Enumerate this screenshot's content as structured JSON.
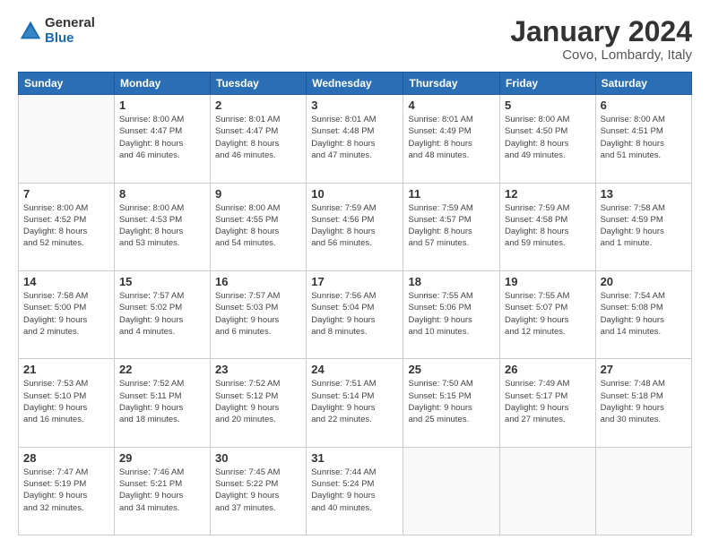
{
  "logo": {
    "general": "General",
    "blue": "Blue"
  },
  "header": {
    "title": "January 2024",
    "subtitle": "Covo, Lombardy, Italy"
  },
  "weekdays": [
    "Sunday",
    "Monday",
    "Tuesday",
    "Wednesday",
    "Thursday",
    "Friday",
    "Saturday"
  ],
  "weeks": [
    [
      {
        "day": "",
        "info": ""
      },
      {
        "day": "1",
        "info": "Sunrise: 8:00 AM\nSunset: 4:47 PM\nDaylight: 8 hours\nand 46 minutes."
      },
      {
        "day": "2",
        "info": "Sunrise: 8:01 AM\nSunset: 4:47 PM\nDaylight: 8 hours\nand 46 minutes."
      },
      {
        "day": "3",
        "info": "Sunrise: 8:01 AM\nSunset: 4:48 PM\nDaylight: 8 hours\nand 47 minutes."
      },
      {
        "day": "4",
        "info": "Sunrise: 8:01 AM\nSunset: 4:49 PM\nDaylight: 8 hours\nand 48 minutes."
      },
      {
        "day": "5",
        "info": "Sunrise: 8:00 AM\nSunset: 4:50 PM\nDaylight: 8 hours\nand 49 minutes."
      },
      {
        "day": "6",
        "info": "Sunrise: 8:00 AM\nSunset: 4:51 PM\nDaylight: 8 hours\nand 51 minutes."
      }
    ],
    [
      {
        "day": "7",
        "info": "Sunrise: 8:00 AM\nSunset: 4:52 PM\nDaylight: 8 hours\nand 52 minutes."
      },
      {
        "day": "8",
        "info": "Sunrise: 8:00 AM\nSunset: 4:53 PM\nDaylight: 8 hours\nand 53 minutes."
      },
      {
        "day": "9",
        "info": "Sunrise: 8:00 AM\nSunset: 4:55 PM\nDaylight: 8 hours\nand 54 minutes."
      },
      {
        "day": "10",
        "info": "Sunrise: 7:59 AM\nSunset: 4:56 PM\nDaylight: 8 hours\nand 56 minutes."
      },
      {
        "day": "11",
        "info": "Sunrise: 7:59 AM\nSunset: 4:57 PM\nDaylight: 8 hours\nand 57 minutes."
      },
      {
        "day": "12",
        "info": "Sunrise: 7:59 AM\nSunset: 4:58 PM\nDaylight: 8 hours\nand 59 minutes."
      },
      {
        "day": "13",
        "info": "Sunrise: 7:58 AM\nSunset: 4:59 PM\nDaylight: 9 hours\nand 1 minute."
      }
    ],
    [
      {
        "day": "14",
        "info": "Sunrise: 7:58 AM\nSunset: 5:00 PM\nDaylight: 9 hours\nand 2 minutes."
      },
      {
        "day": "15",
        "info": "Sunrise: 7:57 AM\nSunset: 5:02 PM\nDaylight: 9 hours\nand 4 minutes."
      },
      {
        "day": "16",
        "info": "Sunrise: 7:57 AM\nSunset: 5:03 PM\nDaylight: 9 hours\nand 6 minutes."
      },
      {
        "day": "17",
        "info": "Sunrise: 7:56 AM\nSunset: 5:04 PM\nDaylight: 9 hours\nand 8 minutes."
      },
      {
        "day": "18",
        "info": "Sunrise: 7:55 AM\nSunset: 5:06 PM\nDaylight: 9 hours\nand 10 minutes."
      },
      {
        "day": "19",
        "info": "Sunrise: 7:55 AM\nSunset: 5:07 PM\nDaylight: 9 hours\nand 12 minutes."
      },
      {
        "day": "20",
        "info": "Sunrise: 7:54 AM\nSunset: 5:08 PM\nDaylight: 9 hours\nand 14 minutes."
      }
    ],
    [
      {
        "day": "21",
        "info": "Sunrise: 7:53 AM\nSunset: 5:10 PM\nDaylight: 9 hours\nand 16 minutes."
      },
      {
        "day": "22",
        "info": "Sunrise: 7:52 AM\nSunset: 5:11 PM\nDaylight: 9 hours\nand 18 minutes."
      },
      {
        "day": "23",
        "info": "Sunrise: 7:52 AM\nSunset: 5:12 PM\nDaylight: 9 hours\nand 20 minutes."
      },
      {
        "day": "24",
        "info": "Sunrise: 7:51 AM\nSunset: 5:14 PM\nDaylight: 9 hours\nand 22 minutes."
      },
      {
        "day": "25",
        "info": "Sunrise: 7:50 AM\nSunset: 5:15 PM\nDaylight: 9 hours\nand 25 minutes."
      },
      {
        "day": "26",
        "info": "Sunrise: 7:49 AM\nSunset: 5:17 PM\nDaylight: 9 hours\nand 27 minutes."
      },
      {
        "day": "27",
        "info": "Sunrise: 7:48 AM\nSunset: 5:18 PM\nDaylight: 9 hours\nand 30 minutes."
      }
    ],
    [
      {
        "day": "28",
        "info": "Sunrise: 7:47 AM\nSunset: 5:19 PM\nDaylight: 9 hours\nand 32 minutes."
      },
      {
        "day": "29",
        "info": "Sunrise: 7:46 AM\nSunset: 5:21 PM\nDaylight: 9 hours\nand 34 minutes."
      },
      {
        "day": "30",
        "info": "Sunrise: 7:45 AM\nSunset: 5:22 PM\nDaylight: 9 hours\nand 37 minutes."
      },
      {
        "day": "31",
        "info": "Sunrise: 7:44 AM\nSunset: 5:24 PM\nDaylight: 9 hours\nand 40 minutes."
      },
      {
        "day": "",
        "info": ""
      },
      {
        "day": "",
        "info": ""
      },
      {
        "day": "",
        "info": ""
      }
    ]
  ]
}
